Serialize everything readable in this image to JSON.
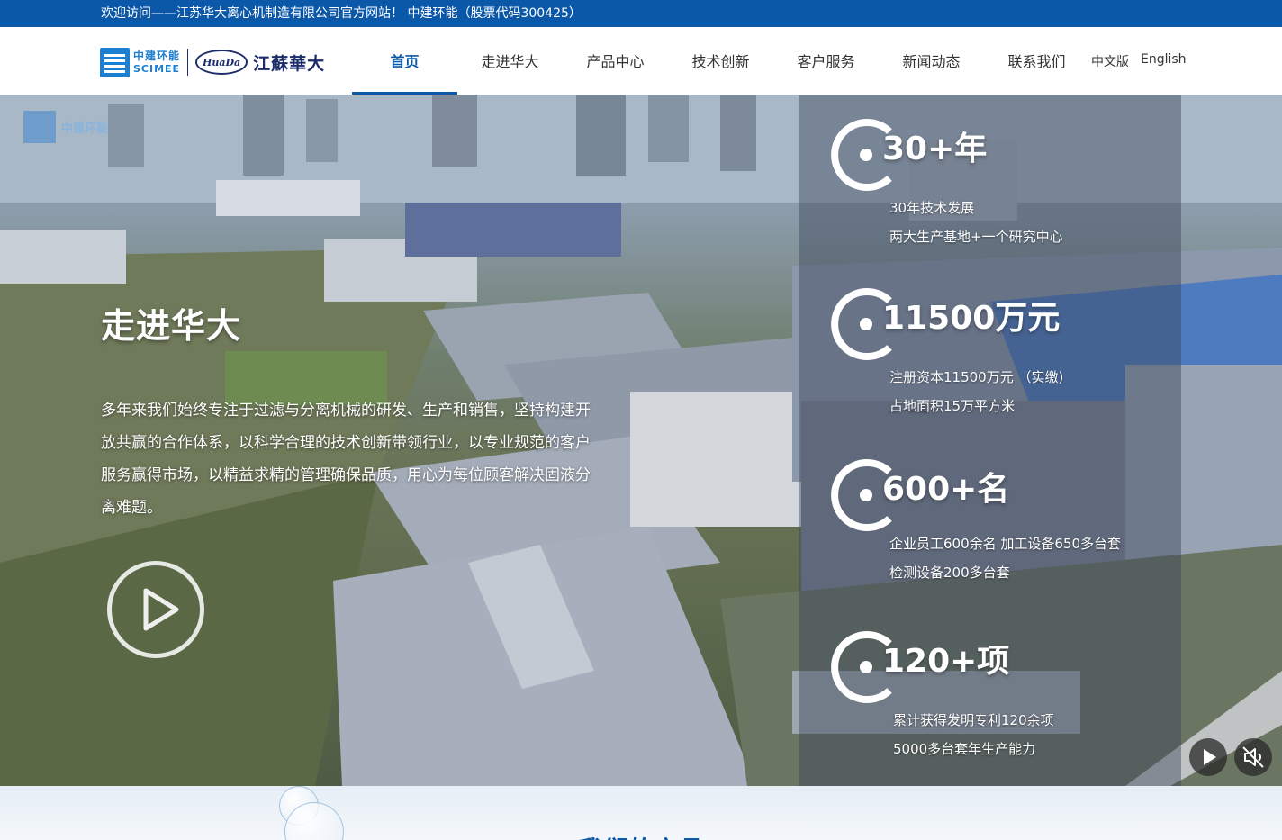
{
  "topbar": {
    "welcome": "欢迎访问——江苏华大离心机制造有限公司官方网站！ 中建环能（股票代码300425）"
  },
  "logo": {
    "brand_cn": "中建环能",
    "brand_en": "SCIMEE",
    "huada_en": "HuaDa",
    "huada_cn": "江蘇華大"
  },
  "nav": {
    "items": [
      {
        "label": "首页"
      },
      {
        "label": "走进华大"
      },
      {
        "label": "产品中心"
      },
      {
        "label": "技术创新"
      },
      {
        "label": "客户服务"
      },
      {
        "label": "新闻动态"
      },
      {
        "label": "联系我们"
      }
    ],
    "active_index": 0,
    "lang_cn": "中文版",
    "lang_en": "English"
  },
  "hero": {
    "title": "走进华大",
    "description": "多年来我们始终专注于过滤与分离机械的研发、生产和销售，坚持构建开放共赢的合作体系，以科学合理的技术创新带领行业，以专业规范的客户服务赢得市场，以精益求精的管理确保品质，用心为每位顾客解决固液分离难题。"
  },
  "stats": [
    {
      "number": "30+年",
      "line1": "30年技术发展",
      "line2": "两大生产基地+一个研究中心"
    },
    {
      "number": "11500万元",
      "line1": "注册资本11500万元 （实缴)",
      "line2": "占地面积15万平方米"
    },
    {
      "number": "600+名",
      "line1": "企业员工600余名 加工设备650多台套 检测设备200多台套",
      "line2": ""
    },
    {
      "number": "120+项",
      "line1": "累计获得发明专利120余项",
      "line2": "5000多台套年生产能力"
    }
  ],
  "section": {
    "title": "我们的产品"
  },
  "colors": {
    "brand_blue": "#0b57a8",
    "logo_blue": "#1d7fd1",
    "navy": "#1d2c6b"
  },
  "icons": [
    "play-circle-icon",
    "play-icon",
    "mute-icon"
  ]
}
